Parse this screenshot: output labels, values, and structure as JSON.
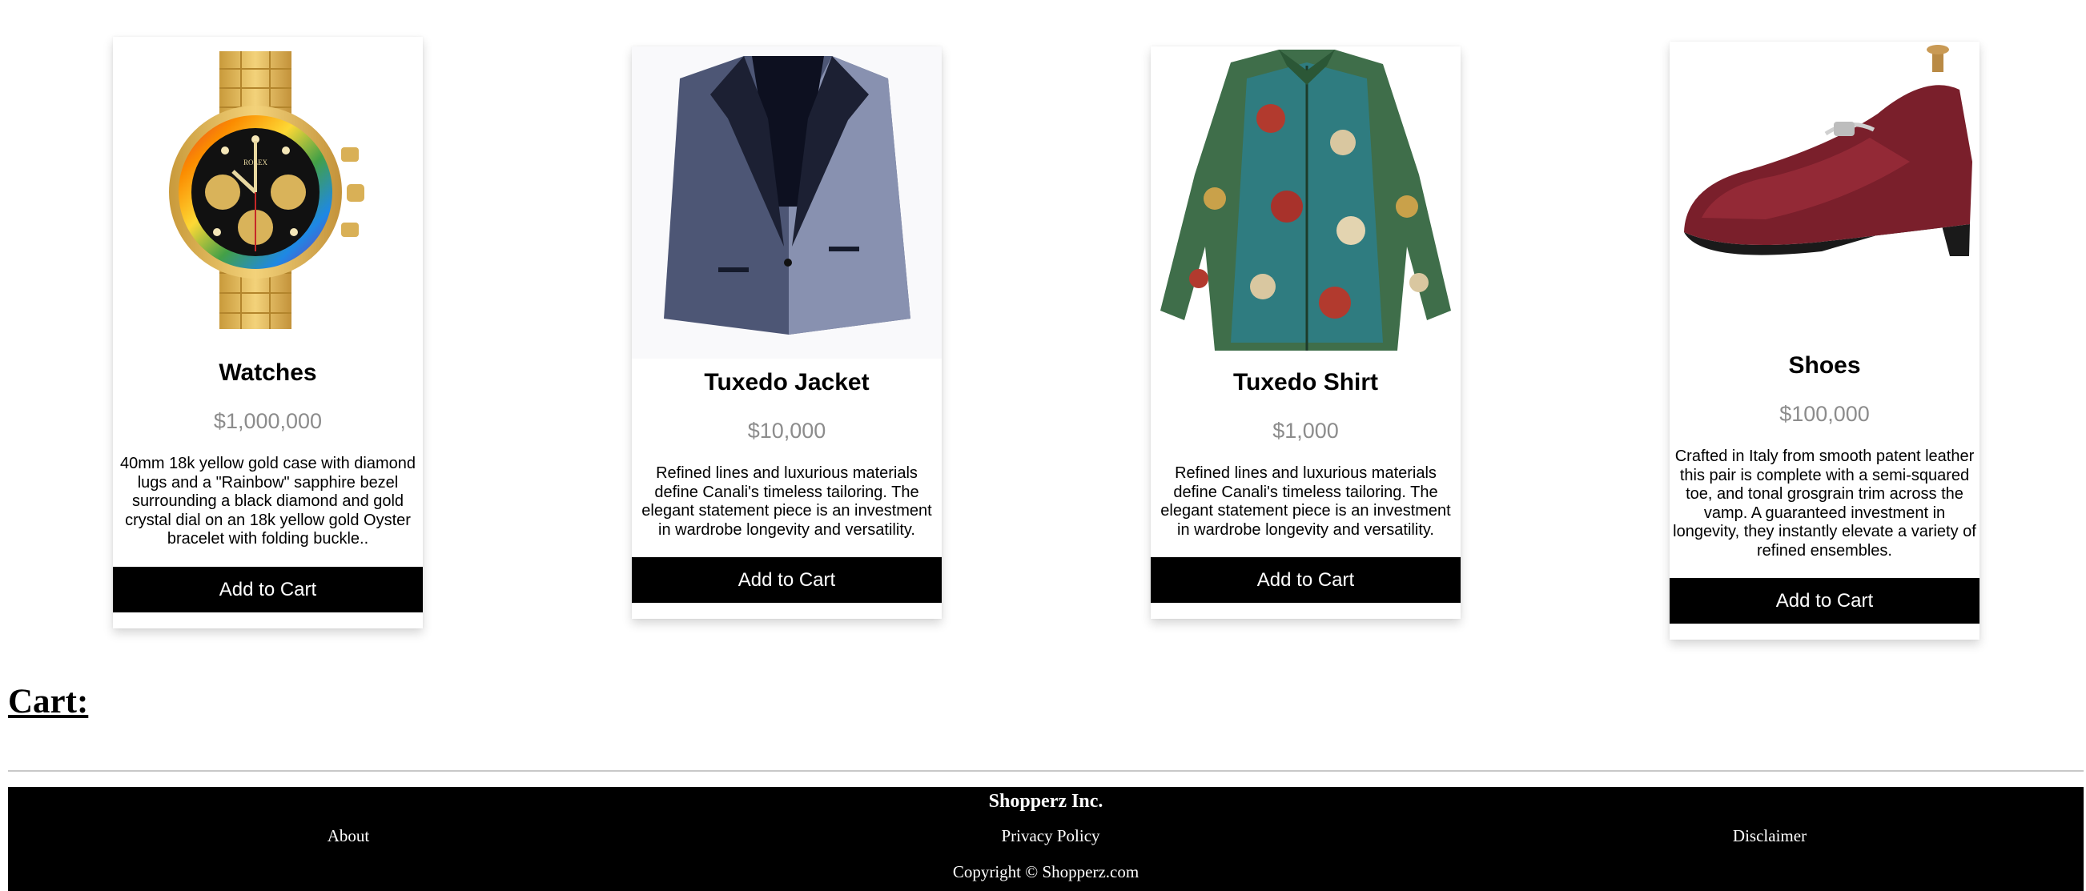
{
  "products": [
    {
      "name": "Watches",
      "price": "$1,000,000",
      "description": "40mm 18k yellow gold case with diamond lugs and a \"Rainbow\" sapphire bezel surrounding a black diamond and gold crystal dial on an 18k yellow gold Oyster bracelet with folding buckle..",
      "button": "Add to Cart",
      "image_icon": "gold-watch-image"
    },
    {
      "name": "Tuxedo Jacket",
      "price": "$10,000",
      "description": "Refined lines and luxurious materials define Canali's timeless tailoring. The elegant statement piece is an investment in wardrobe longevity and versatility.",
      "button": "Add to Cart",
      "image_icon": "tuxedo-jacket-image"
    },
    {
      "name": "Tuxedo Shirt",
      "price": "$1,000",
      "description": "Refined lines and luxurious materials define Canali's timeless tailoring. The elegant statement piece is an investment in wardrobe longevity and versatility.",
      "button": "Add to Cart",
      "image_icon": "paisley-shirt-image"
    },
    {
      "name": "Shoes",
      "price": "$100,000",
      "description": "Crafted in Italy from smooth patent leather this pair is complete with a semi-squared toe, and tonal grosgrain trim across the vamp. A guaranteed investment in longevity, they instantly elevate a variety of refined ensembles.",
      "button": "Add to Cart",
      "image_icon": "loafer-shoe-image"
    }
  ],
  "cart": {
    "heading": "Cart:"
  },
  "footer": {
    "company": "Shopperz Inc.",
    "links": [
      "About",
      "Privacy Policy",
      "Disclaimer"
    ],
    "copyright": "Copyright © Shopperz.com"
  },
  "colors": {
    "button_bg": "#000000",
    "button_text": "#ffffff",
    "price_text": "#8c8c8c",
    "footer_bg": "#000000"
  }
}
